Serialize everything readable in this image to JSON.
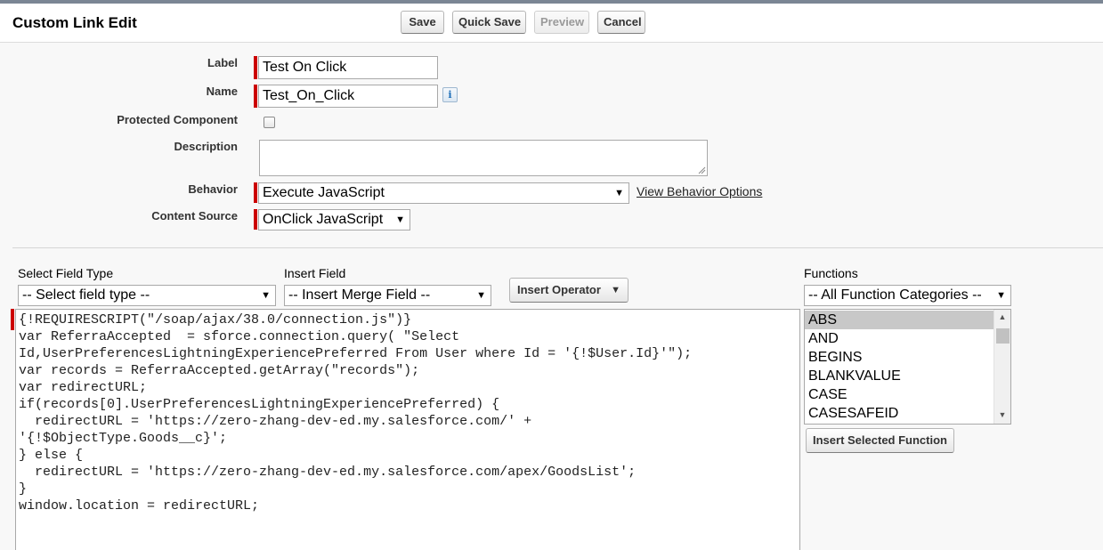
{
  "header": {
    "title": "Custom Link Edit",
    "buttons": {
      "save": "Save",
      "quick_save": "Quick Save",
      "preview": "Preview",
      "cancel": "Cancel"
    }
  },
  "form": {
    "label": {
      "label": "Label",
      "value": "Test On Click"
    },
    "name": {
      "label": "Name",
      "value": "Test_On_Click",
      "info_icon": "info-icon"
    },
    "protected": {
      "label": "Protected Component",
      "checked": false
    },
    "description": {
      "label": "Description",
      "value": ""
    },
    "behavior": {
      "label": "Behavior",
      "value": "Execute JavaScript",
      "link": "View Behavior Options"
    },
    "content_source": {
      "label": "Content Source",
      "value": "OnClick JavaScript"
    }
  },
  "editor": {
    "field_type": {
      "label": "Select Field Type",
      "value": "-- Select field type --"
    },
    "insert_field": {
      "label": "Insert Field",
      "value": "-- Insert Merge Field --"
    },
    "insert_operator": "Insert Operator",
    "code": "{!REQUIRESCRIPT(\"/soap/ajax/38.0/connection.js\")}\nvar ReferraAccepted  = sforce.connection.query( \"Select\nId,UserPreferencesLightningExperiencePreferred From User where Id = '{!$User.Id}'\");\nvar records = ReferraAccepted.getArray(\"records\");\nvar redirectURL;\nif(records[0].UserPreferencesLightningExperiencePreferred) {\n  redirectURL = 'https://zero-zhang-dev-ed.my.salesforce.com/' +\n'{!$ObjectType.Goods__c}';\n} else {\n  redirectURL = 'https://zero-zhang-dev-ed.my.salesforce.com/apex/GoodsList';\n}\nwindow.location = redirectURL;"
  },
  "functions": {
    "label": "Functions",
    "category": "-- All Function Categories --",
    "items": [
      "ABS",
      "AND",
      "BEGINS",
      "BLANKVALUE",
      "CASE",
      "CASESAFEID"
    ],
    "selected": "ABS",
    "insert_button": "Insert Selected Function"
  },
  "colors": {
    "required": "#cc0000",
    "header_strip": "#7b8694",
    "selected_item": "#c8c8c8"
  }
}
